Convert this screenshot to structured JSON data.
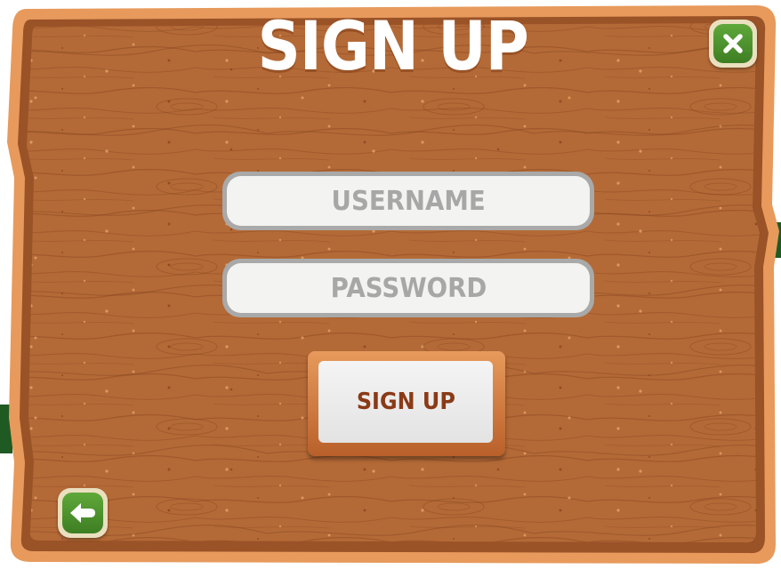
{
  "title": "SIGN UP",
  "form": {
    "username_placeholder": "USERNAME",
    "password_placeholder": "PASSWORD",
    "submit_label": "SIGN UP"
  },
  "icons": {
    "close": "close-icon",
    "back": "back-arrow-icon"
  },
  "colors": {
    "wood": "#b46a37",
    "wood_border": "#e79a5c",
    "title_text": "#ffffff",
    "field_text": "#a7a7a7",
    "button_text": "#8a3a16",
    "icon_button": "#4e9430"
  }
}
